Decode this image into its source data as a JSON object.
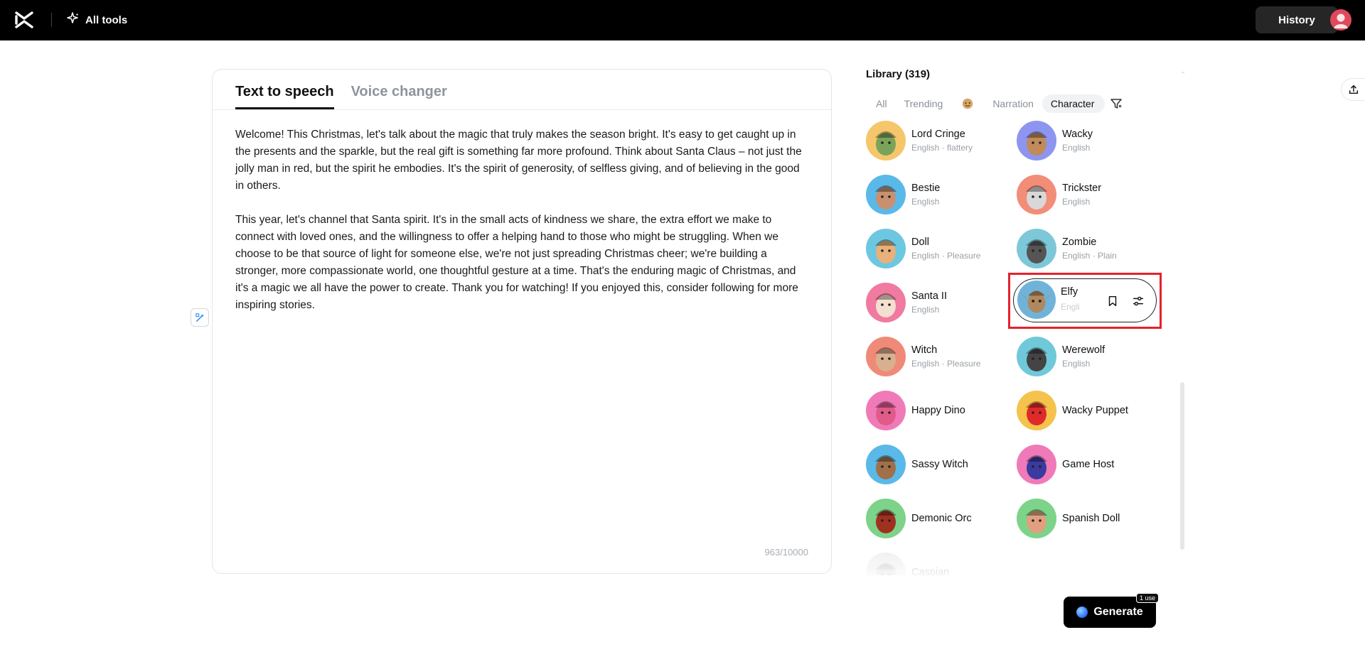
{
  "topbar": {
    "all_tools_label": "All tools",
    "history_label": "History"
  },
  "editor": {
    "tabs": [
      {
        "label": "Text to speech"
      },
      {
        "label": "Voice changer"
      }
    ],
    "paragraphs": [
      "Welcome! This Christmas, let's talk about the magic that truly makes the season bright. It's easy to get caught up in the presents and the sparkle, but the real gift is something far more profound. Think about Santa Claus – not just the jolly man in red, but the spirit he embodies. It's the spirit of generosity, of selfless giving, and of believing in the good in others.",
      "This year, let's channel that Santa spirit. It's in the small acts of kindness we share, the extra effort we make to connect with loved ones, and the willingness to offer a helping hand to those who might be struggling. When we choose to be that source of light for someone else, we're not just spreading Christmas cheer; we're building a stronger, more compassionate world, one thoughtful gesture at a time. That's the enduring magic of Christmas, and it's a magic we all have the power to create. Thank you for watching! If you enjoyed this, consider following for more inspiring stories."
    ],
    "counter": "963/10000"
  },
  "library": {
    "title": "Library (319)",
    "filters": {
      "all": "All",
      "trending": "Trending",
      "narration": "Narration",
      "character": "Character"
    },
    "voices": [
      {
        "name": "Lord Cringe",
        "meta": "English · flattery",
        "color": "#f5c66b"
      },
      {
        "name": "Wacky",
        "meta": "English",
        "color": "#8d95f0"
      },
      {
        "name": "Bestie",
        "meta": "English",
        "color": "#5ab9e8"
      },
      {
        "name": "Trickster",
        "meta": "English",
        "color": "#f28d78"
      },
      {
        "name": "Doll",
        "meta": "English · Pleasure",
        "color": "#6cc8e0"
      },
      {
        "name": "Zombie",
        "meta": "English · Plain",
        "color": "#7dc8d8"
      },
      {
        "name": "Santa II",
        "meta": "English",
        "color": "#f07aa0"
      },
      {
        "name": "Elfy",
        "meta": "Engli",
        "color": "#6fb3d9"
      },
      {
        "name": "Witch",
        "meta": "English · Pleasure",
        "color": "#f08a78"
      },
      {
        "name": "Werewolf",
        "meta": "English",
        "color": "#6fc9d8"
      },
      {
        "name": "Happy Dino",
        "meta": "",
        "color": "#f07ab8"
      },
      {
        "name": "Wacky Puppet",
        "meta": "",
        "color": "#f5c34b"
      },
      {
        "name": "Sassy Witch",
        "meta": "",
        "color": "#5ab9e8"
      },
      {
        "name": "Game Host",
        "meta": "",
        "color": "#f07ab8"
      },
      {
        "name": "Demonic Orc",
        "meta": "",
        "color": "#7cd389"
      },
      {
        "name": "Spanish Doll",
        "meta": "",
        "color": "#7cd389"
      },
      {
        "name": "Caspian",
        "meta": "",
        "color": "#d0d0d0"
      }
    ]
  },
  "generate": {
    "label": "Generate",
    "badge": "1 use"
  }
}
